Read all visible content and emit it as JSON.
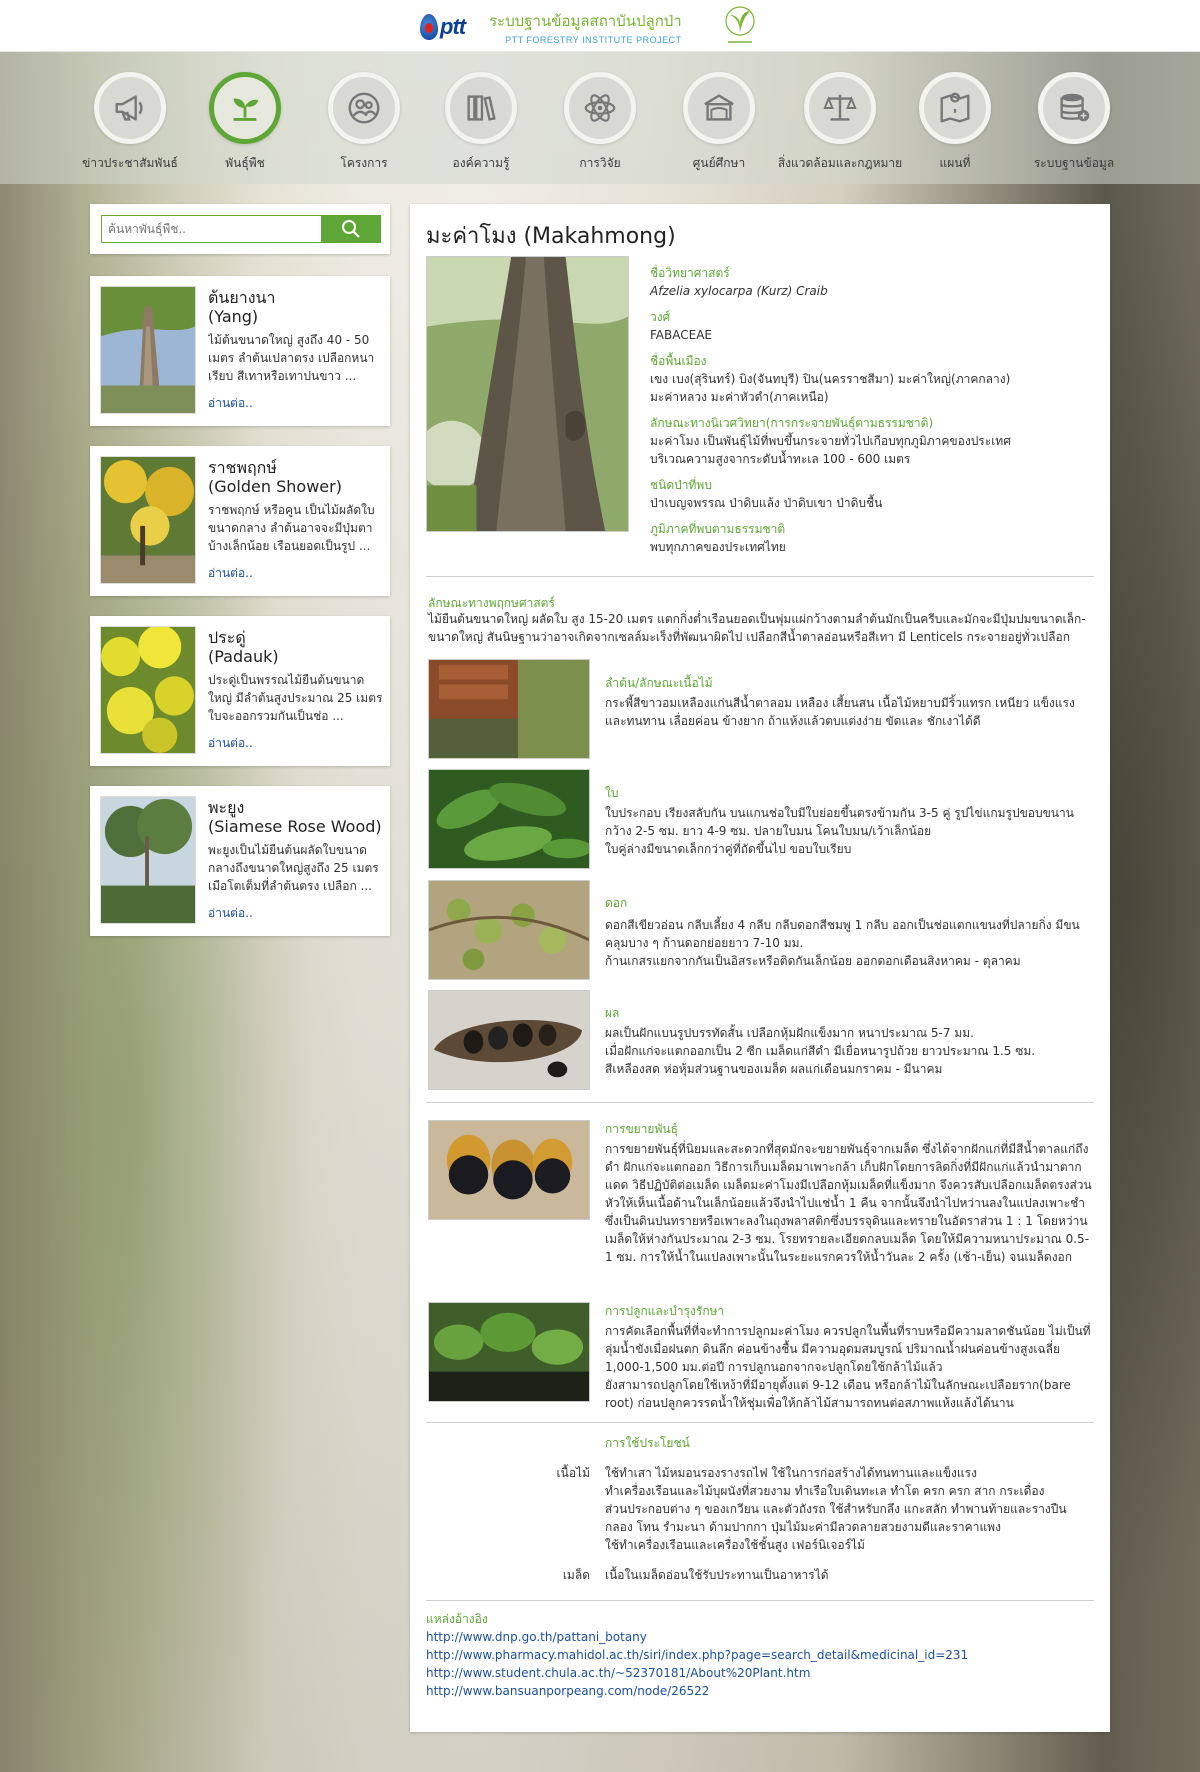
{
  "header": {
    "brand_logo_text": "ptt",
    "title_th": "ระบบฐานข้อมูลสถาบันปลูกป่า",
    "title_en": "PTT FORESTRY INSTITUTE PROJECT",
    "colors": {
      "green": "#5ea635",
      "blue": "#0b3f97",
      "light_blue": "#3aa0d8"
    }
  },
  "nav": [
    {
      "label": "ข่าวประชาสัมพันธ์",
      "icon": "megaphone-icon"
    },
    {
      "label": "พันธุ์พืช",
      "icon": "sprout-icon",
      "active": true
    },
    {
      "label": "โครงการ",
      "icon": "people-icon"
    },
    {
      "label": "องค์ความรู้",
      "icon": "books-icon"
    },
    {
      "label": "การวิจัย",
      "icon": "atom-icon"
    },
    {
      "label": "ศูนย์ศึกษา",
      "icon": "building-icon"
    },
    {
      "label": "สิ่งแวดล้อมและกฎหมาย",
      "icon": "scales-icon"
    },
    {
      "label": "แผนที่",
      "icon": "map-icon"
    },
    {
      "label": "ระบบฐานข้อมูล",
      "icon": "database-icon"
    }
  ],
  "search": {
    "placeholder": "ค้นหาพันธุ์พืช.."
  },
  "cards": [
    {
      "title": "ต้นยางนา\n(Yang)",
      "desc": "ไม้ต้นขนาดใหญ่ สูงถึง 40 - 50 เมตร ลำต้นเปลาตรง เปลือกหนาเรียบ สีเทาหรือเทาปนขาว ...",
      "more": "อ่านต่อ.."
    },
    {
      "title": "ราชพฤกษ์\n(Golden Shower)",
      "desc": "ราชพฤกษ์ หรือคูน เป็นไม้ผลัดใบขนาดกลาง ลำต้นอาจจะมีปุ่มตาบ้างเล็กน้อย เรือนยอดเป็นรูป ...",
      "more": "อ่านต่อ.."
    },
    {
      "title": "ประดู่\n(Padauk)",
      "desc": "ประดู่เป็นพรรณไม้ยืนต้นขนาดใหญ่ มีลำต้นสูงประมาณ 25 เมตร ใบจะออกรวมกันเป็นช่อ ...",
      "more": "อ่านต่อ.."
    },
    {
      "title": "พะยูง\n(Siamese Rose Wood)",
      "desc": " พะยูงเป็นไม้ยืนต้นผลัดใบขนาดกลางถึงขนาดใหญ่สูงถึง 25 เมตร เมือโตเต็มที่ลำต้นตรง เปลือก ...",
      "more": "อ่านต่อ.."
    }
  ],
  "detail": {
    "title": "มะค่าโมง (Makahmong)",
    "info": [
      {
        "label": "ชื่อวิทยาศาสตร์",
        "value": "Afzelia xylocarpa (Kurz) Craib",
        "italic": true
      },
      {
        "label": "วงศ์",
        "value": "FABACEAE"
      },
      {
        "label": "ชื่อพื้นเมือง",
        "value": "เขง เบง(สุรินทร์)  บิง(จันทบุรี)  ปิน(นครราชสีมา)  มะค่าใหญ่(ภาคกลาง)\nมะค่าหลวง มะค่าหัวดำ(ภาคเหนือ)"
      },
      {
        "label": "ลักษณะทางนิเวศวิทยา(การกระจายพันธุ์ตามธรรมชาติ)",
        "value": "มะค่าโมง เป็นพันธุ์ไม้ที่พบขึ้นกระจายทั่วไปเกือบทุกภูมิภาคของประเทศ\nบริเวณความสูงจากระดับน้ำทะเล 100 - 600 เมตร"
      },
      {
        "label": "ชนิดป่าที่พบ",
        "value": "ป่าเบญจพรรณ ป่าดิบแล้ง ป่าดิบเขา ป่าดิบชื้น"
      },
      {
        "label": "ภูมิภาคที่พบตามธรรมชาติ",
        "value": "พบทุกภาคของประเทศไทย"
      }
    ],
    "botany": {
      "label": "ลักษณะทางพฤกษศาสตร์",
      "text": "ไม้ยืนต้นขนาดใหญ่ ผลัดใบ สูง 15-20 เมตร แตกกิ่งต่ำเรือนยอดเป็นพุ่มแผ่กว้างตามลำต้นมักเป็นครีบและมักจะมีปุ่มปมขนาดเล็ก-ขนาดใหญ่ สันนิษฐานว่าอาจเกิดจากเซลล์มะเร็งที่พัฒนาผิดไป เปลือกสีน้ำตาลอ่อนหรือสีเทา มี Lenticels กระจายอยู่ทั่วเปลือก"
    },
    "parts": [
      {
        "label": "ลำต้น/ลักษณะเนื้อไม้",
        "text": "กระพี้สีขาวอมเหลืองแก่นสีน้ำตาลอม เหลือง เสี้ยนสน เนื้อไม้หยาบมีริ้วแทรก เหนียว แข็งแรงและทนทาน เลื่อยค่อน ข้างยาก ถ้าแห้งแล้วตบแต่งง่าย ขัดและ ชักเงาได้ดี",
        "image": "wood-photo"
      },
      {
        "label": "ใบ",
        "text": "ใบประกอบ เรียงสลับกัน บนแกนช่อใบมีใบย่อยขึ้นตรงข้ามกัน 3-5 คู่ รูปไข่แกมรูปขอบขนาน กว้าง 2-5 ซม. ยาว 4-9 ซม. ปลายใบมน   โคนใบมน/เว้าเล็กน้อย\nใบคู่ล่างมีขนาดเล็กกว่าคู่ที่ถัดขึ้นไป ขอบใบเรียบ",
        "image": "leaf-photo"
      },
      {
        "label": "ดอก",
        "text": "ดอกสีเขียวอ่อน กลีบเลี้ยง 4 กลีบ กลีบดอกสีชมพู 1 กลีบ ออกเป็นช่อแตกแขนงที่ปลายกิ่ง มีขนคลุมบาง ๆ ก้านดอกย่อยยาว 7-10 มม.\nก้านเกสรแยกจากกันเป็นอิสระหรือติดกันเล็กน้อย ออกดอกเดือนสิงหาคม - ตุลาคม",
        "image": "flower-photo"
      },
      {
        "label": "ผล",
        "text": "ผลเป็นฝักแบนรูปบรรทัดสั้น เปลือกหุ้มฝักแข็งมาก หนาประมาณ 5-7 มม.\nเมื่อฝักแก่จะแตกออกเป็น 2 ซีก เมล็ดแก่สีดำ มีเยื่อหนารูปถ้วย ยาวประมาณ 1.5 ซม.\nสีเหลืองสด ห่อหุ้มส่วนฐานของเมล็ด  ผลแก่เดือนมกราคม - มีนาคม",
        "image": "fruit-photo"
      }
    ],
    "propagation": {
      "label": "การขยายพันธุ์",
      "text": "การขยายพันธุ์ที่นิยมและสะดวกที่สุดมักจะขยายพันธุ์จากเมล็ด ซึ่งได้จากฝักแก่ที่มีสีน้ำตาลแก่ถึงดำ ฝักแก่จะแตกออก วิธีการเก็บเมล็ดมาเพาะกล้า เก็บฝักโดยการลิดกิ่งที่มีฝักแก่แล้วนำมาตากแดด วิธีปฏิบัติต่อเมล็ด เมล็ดมะค่าโมงมีเปลือกหุ้มเมล็ดที่แข็งมาก จึงควรสับเปลือกเมล็ดตรงส่วนหัวให้เห็นเนื้อด้านในเล็กน้อยแล้วจึงนำไปแช่น้ำ 1 คืน จากนั้นจึงนำไปหว่านลงในแปลงเพาะชำซึ่งเป็นดินปนทรายหรือเพาะลงในถุงพลาสติกซึ่งบรรจุดินและทรายในอัตราส่วน 1 : 1 โดยหว่านเมล็ดให้ห่างกันประมาณ 2-3 ซม. โรยทรายละเอียดกลบเมล็ด โดยให้มีความหนาประมาณ 0.5-1 ซม. การให้น้ำในแปลงเพาะนั้นในระยะแรกควรให้น้ำวันละ 2 ครั้ง (เช้า-เย็น) จนเมล็ดงอก",
      "image": "seed-photo"
    },
    "planting": {
      "label": "การปลูกและบำรุงรักษา",
      "text": "การคัดเลือกพื้นที่ที่จะทำการปลูกมะค่าโมง ควรปลูกในพื้นที่ราบหรือมีความลาดชันน้อย ไม่เป็นที่ลุ่มน้ำขังเมื่อฝนตก ดินลึก ค่อนข้างชื้น มีความอุดมสมบูรณ์ ปริมาณน้ำฝนค่อนข้างสูงเฉลี่ย 1,000-1,500 มม.ต่อปี การปลูกนอกจากจะปลูกโดยใช้กล้าไม้แล้ว\nยังสามารถปลูกโดยใช้เหง้าที่มีอายุตั้งแต่ 9-12 เดือน หรือกล้าไม้ในลักษณะเปลือยราก(bare root) ก่อนปลูกควรรดน้ำให้ชุ่มเพื่อให้กล้าไม้สามารถทนต่อสภาพแห้งแล้งได้นาน",
      "image": "seedling-photo"
    },
    "uses": {
      "label": "การใช้ประโยชน์",
      "items": [
        {
          "part": "เนื้อไม้",
          "text": "ใช้ทำเสา ไม้หมอนรองรางรถไฟ ใช้ในการก่อสร้างได้ทนทานและแข็งแรง\nทำเครื่องเรือนและไม้บุผนังที่สวยงาม ทำเรือใบเดินทะเล  ทำโต ครก ครก สาก กระเดื่อง\nส่วนประกอบต่าง ๆ ของเกวียน และตัวถังรถ ใช้สำหรับกลึง แกะสลัก ทำพานท้ายและรางปืน\nกลอง โทน รำมะนา ด้ามปากกา ปุ่มไม้มะค่ามีลวดลายสวยงามดีและราคาแพง\nใช้ทำเครื่องเรือนและเครื่องใช้ชั้นสูง เฟอร์นิเจอร์ไม้"
        },
        {
          "part": "เมล็ด",
          "text": "เนื้อในเมล็ดอ่อนใช้รับประทานเป็นอาหารได้"
        }
      ]
    },
    "references": {
      "label": "แหล่งอ้างอิง",
      "links": [
        "http://www.dnp.go.th/pattani_botany",
        "http://www.pharmacy.mahidol.ac.th/siri/index.php?page=search_detail&medicinal_id=231",
        "http://www.student.chula.ac.th/~52370181/About%20Plant.htm",
        "http://www.bansuanporpeang.com/node/26522"
      ]
    }
  }
}
